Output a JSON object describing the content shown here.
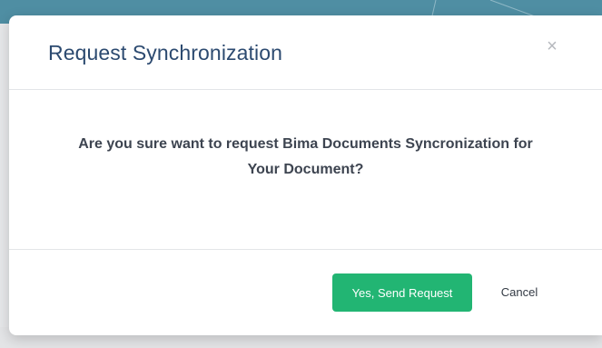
{
  "colors": {
    "backdrop_accent": "#4f8ea3",
    "title": "#2c4a70",
    "confirm_button": "#22b573"
  },
  "modal": {
    "title": "Request Synchronization",
    "close_icon": "close-icon",
    "close_glyph": "×",
    "message_line1": "Are you sure want to request Bima Documents Syncronization for",
    "message_line2": "Your Document?",
    "confirm_label": "Yes, Send Request",
    "cancel_label": "Cancel"
  }
}
